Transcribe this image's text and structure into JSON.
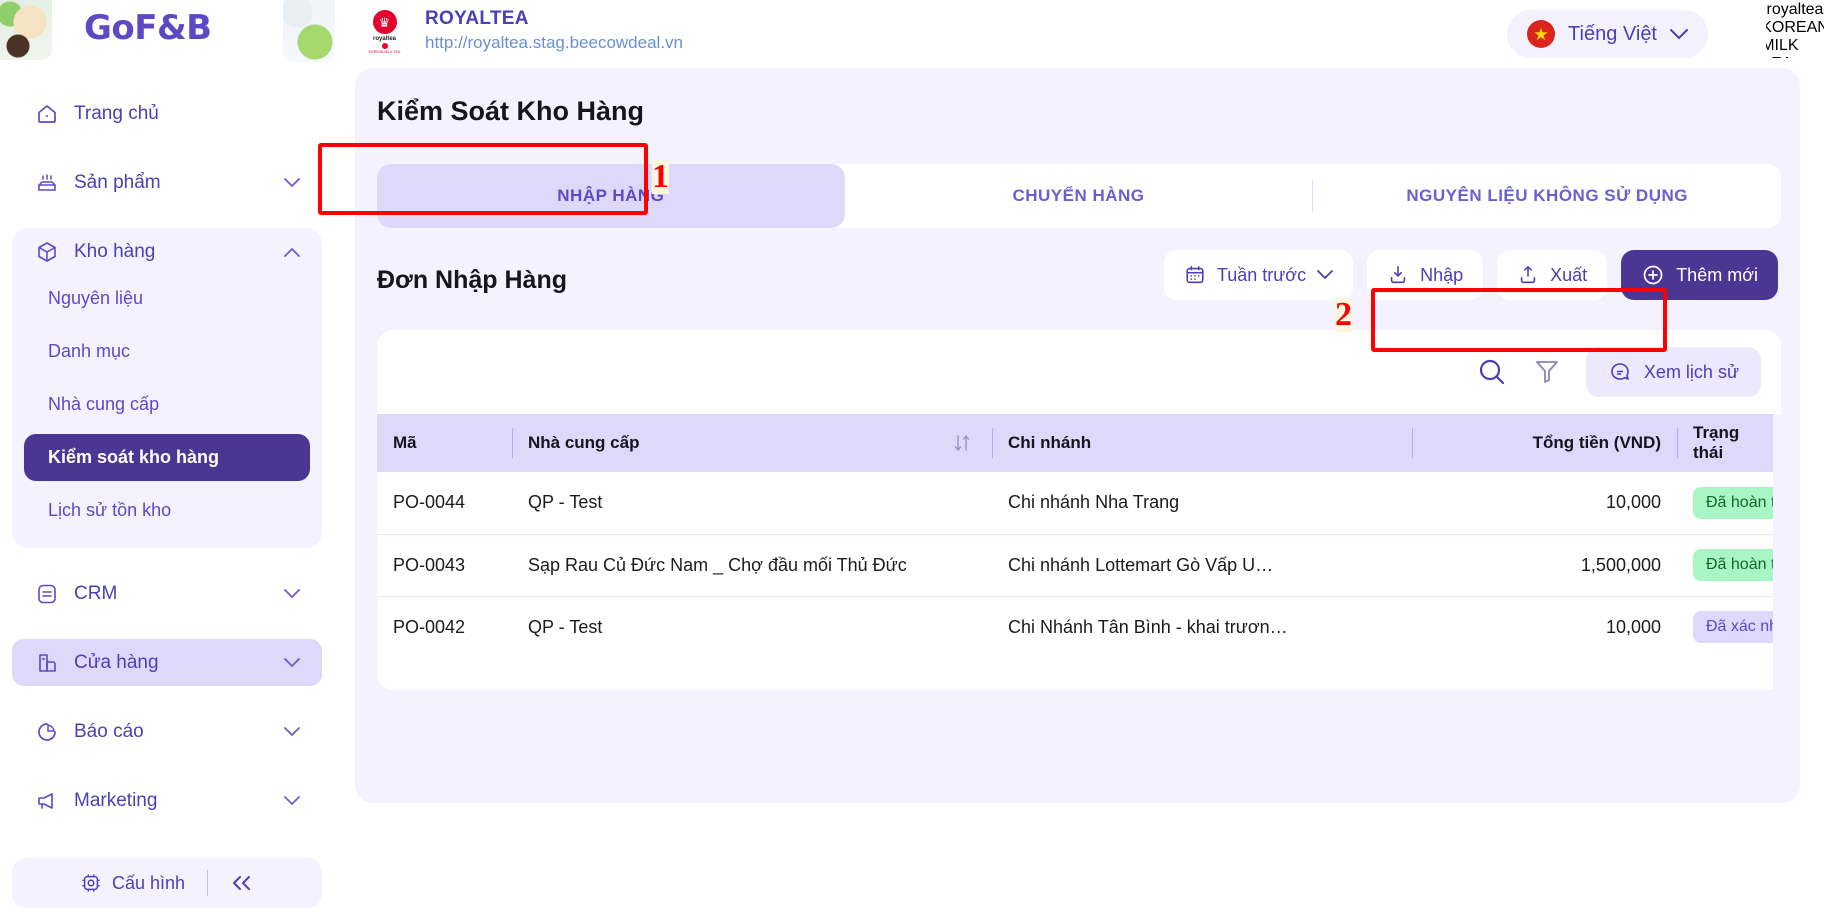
{
  "header": {
    "brand": "GoF&B",
    "tenant_name": "ROYALTEA",
    "tenant_url": "http://royaltea.stag.beecowdeal.vn",
    "language": "Tiếng Việt",
    "logo_text": "royaltea",
    "logo_sub": "KOREAN MILK TEA"
  },
  "sidebar": {
    "items": [
      {
        "label": "Trang chủ",
        "icon": "home-icon",
        "expandable": false
      },
      {
        "label": "Sản phẩm",
        "icon": "cake-icon",
        "expandable": true
      },
      {
        "label": "Kho hàng",
        "icon": "box-icon",
        "expandable": true,
        "expanded": true
      },
      {
        "label": "CRM",
        "icon": "list-icon",
        "expandable": true
      },
      {
        "label": "Cửa hàng",
        "icon": "store-icon",
        "expandable": true
      },
      {
        "label": "Báo cáo",
        "icon": "pie-chart-icon",
        "expandable": true
      },
      {
        "label": "Marketing",
        "icon": "megaphone-icon",
        "expandable": true
      }
    ],
    "warehouse_children": [
      {
        "label": "Nguyên liệu",
        "active": false
      },
      {
        "label": "Danh mục",
        "active": false
      },
      {
        "label": "Nhà cung cấp",
        "active": false
      },
      {
        "label": "Kiểm soát kho hàng",
        "active": true
      },
      {
        "label": "Lịch sử tồn kho",
        "active": false
      }
    ],
    "footer": {
      "config_label": "Cấu hình",
      "collapse_label": "«"
    }
  },
  "page": {
    "title": "Kiểm Soát Kho Hàng",
    "tabs": [
      {
        "label": "NHẬP HÀNG",
        "active": true
      },
      {
        "label": "CHUYỂN HÀNG",
        "active": false
      },
      {
        "label": "NGUYÊN LIỆU KHÔNG SỬ DỤNG",
        "active": false
      }
    ],
    "section_title": "Đơn Nhập Hàng",
    "toolbar": {
      "date_range": "Tuần trước",
      "import_label": "Nhập",
      "export_label": "Xuất",
      "add_label": "Thêm mới"
    },
    "card_toolbar": {
      "history_label": "Xem lịch sử",
      "search_icon": "search-icon",
      "filter_icon": "filter-funnel-icon"
    }
  },
  "table": {
    "columns": [
      {
        "label": "Mã",
        "align": "left"
      },
      {
        "label": "Nhà cung cấp",
        "align": "left",
        "sortable": true
      },
      {
        "label": "Chi nhánh",
        "align": "left"
      },
      {
        "label": "Tổng tiền (VND)",
        "align": "right"
      },
      {
        "label": "Trạng thái",
        "align": "left"
      }
    ],
    "rows": [
      {
        "code": "PO-0044",
        "supplier": "QP - Test",
        "branch": "Chi nhánh Nha Trang",
        "total": "10,000",
        "status": "Đã hoàn thành",
        "status_kind": "done"
      },
      {
        "code": "PO-0043",
        "supplier": "Sạp Rau Củ Đức Nam _ Chợ đầu mối Thủ Đức",
        "branch": "Chi nhánh Lottemart Gò Vấp U…",
        "total": "1,500,000",
        "status": "Đã hoàn thành",
        "status_kind": "done"
      },
      {
        "code": "PO-0042",
        "supplier": "QP - Test",
        "branch": "Chi Nhánh Tân Bình - khai trươn…",
        "total": "10,000",
        "status": "Đã xác nhận",
        "status_kind": "confirmed"
      }
    ]
  },
  "annotations": [
    {
      "number": "1",
      "target": "tab-nhap-hang"
    },
    {
      "number": "2",
      "target": "view-history-button"
    }
  ],
  "colors": {
    "brand_purple": "#5b4ac4",
    "deep_purple": "#4b3694",
    "light_lilac": "#ded8fb",
    "page_bg": "#f4f2fe",
    "annotation_red": "#ff0000",
    "status_done_bg": "#a9f5c4",
    "status_confirmed_bg": "#ded8fb"
  }
}
